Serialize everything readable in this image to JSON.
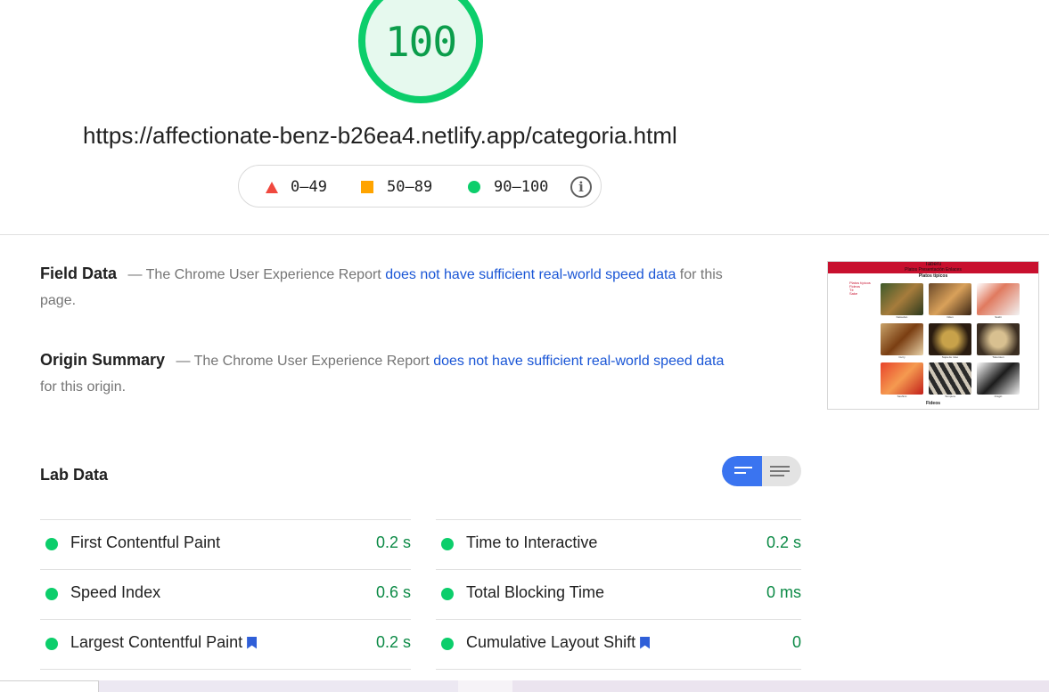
{
  "score": {
    "value": "100",
    "color": "#0cce6b"
  },
  "url": "https://affectionate-benz-b26ea4.netlify.app/categoria.html",
  "legend": {
    "fail": "0–49",
    "average": "50–89",
    "pass": "90–100",
    "info_icon": "info-icon"
  },
  "field_data": {
    "title": "Field Data",
    "prefix": "— The Chrome User Experience Report ",
    "link": "does not have sufficient real-world speed data",
    "suffix": " for this page."
  },
  "origin_summary": {
    "title": "Origin Summary",
    "prefix": "— The Chrome User Experience Report ",
    "link": "does not have sufficient real-world speed data",
    "suffix": " for this origin."
  },
  "thumbnail": {
    "title": "Taberu",
    "menu": "Platos  Presentación  Enlaces",
    "section": "Platos típicos",
    "sidebar": [
      "Platos típicos",
      "Fideos",
      "Té",
      "Sake"
    ],
    "captions": [
      "Katsudon",
      "Oden",
      "Sushi",
      "Curry",
      "Sopa de miso",
      "Tokoroten",
      "Sashimi",
      "Tempura",
      "Onigiri"
    ],
    "footer": "Fideos"
  },
  "lab_data": {
    "title": "Lab Data",
    "toggle": {
      "left_icon": "view-summary-icon",
      "right_icon": "view-list-icon"
    },
    "metrics_left": [
      {
        "label": "First Contentful Paint",
        "value": "0.2 s",
        "bookmark": false
      },
      {
        "label": "Speed Index",
        "value": "0.6 s",
        "bookmark": false
      },
      {
        "label": "Largest Contentful Paint",
        "value": "0.2 s",
        "bookmark": true
      }
    ],
    "metrics_right": [
      {
        "label": "Time to Interactive",
        "value": "0.2 s",
        "bookmark": false
      },
      {
        "label": "Total Blocking Time",
        "value": "0 ms",
        "bookmark": false
      },
      {
        "label": "Cumulative Layout Shift",
        "value": "0",
        "bookmark": true
      }
    ]
  },
  "colors": {
    "pass": "#0cce6b",
    "average": "#ffa400",
    "fail": "#f0483e",
    "link": "#1a56d6",
    "accent": "#3a74f0"
  }
}
